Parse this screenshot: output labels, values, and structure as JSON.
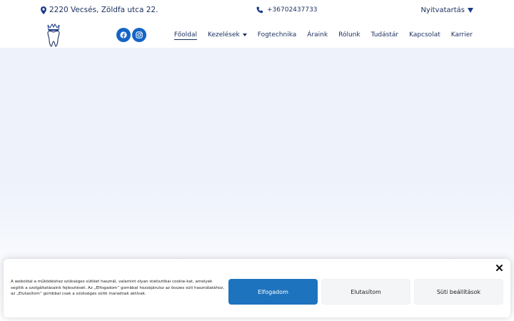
{
  "topbar": {
    "address": "2220 Vecsés, Zöldfa utca 22.",
    "phone": "+36702437733",
    "hours_label": "Nyitvatartás",
    "icons": {
      "address": "map-pin-icon",
      "phone": "phone-icon",
      "hours": "triangle-down-icon"
    }
  },
  "header": {
    "social": [
      {
        "icon": "facebook-icon"
      },
      {
        "icon": "instagram-icon"
      }
    ],
    "nav": [
      {
        "label": "Főoldal",
        "active": true
      },
      {
        "label": "Kezelések",
        "has_dropdown": true
      },
      {
        "label": "Fogtechnika"
      },
      {
        "label": "Áraink"
      },
      {
        "label": "Rólunk"
      },
      {
        "label": "Tudástár"
      },
      {
        "label": "Kapcsolat"
      },
      {
        "label": "Karrier"
      }
    ]
  },
  "cookie": {
    "text": "A weboldal a működéshez szükséges sütiket használ, valamint olyan statisztikai cookie-kat, amelyek segítik a szolgáltatásaink fejlesztését. Az „Elfogadom” gombbal hozzájárulsz az összes süti használatához, az „Elutasítom” gombbal csak a szükséges sütik maradnak aktívak.",
    "accept_label": "Elfogadom",
    "deny_label": "Elutasítom",
    "settings_label": "Süti beállítások"
  },
  "colors": {
    "brand_dark": "#1a2f5e",
    "brand_blue": "#1565c7",
    "accept_blue": "#1e73be",
    "hero_bg": "#eef2fb"
  }
}
